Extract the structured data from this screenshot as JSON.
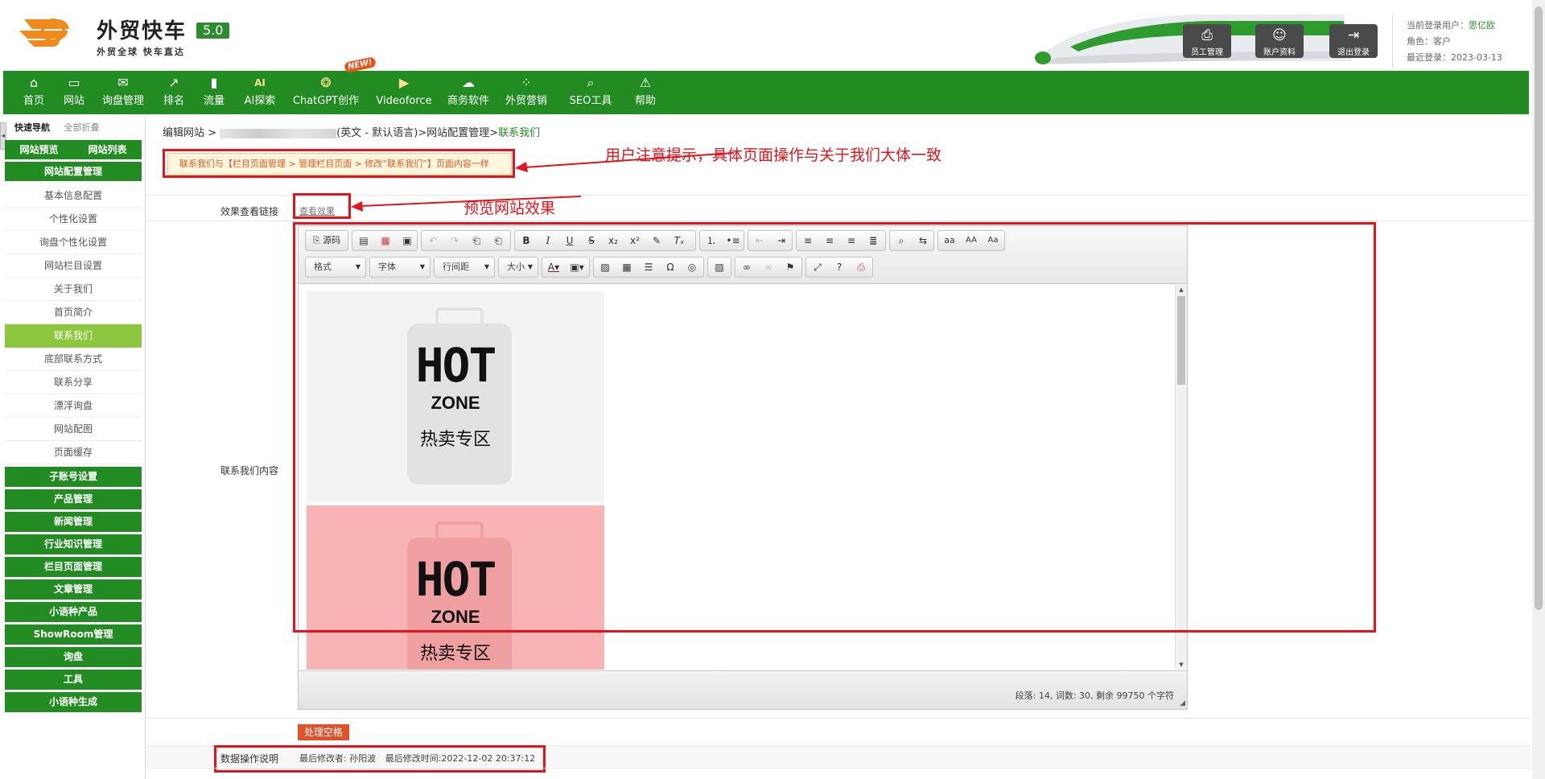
{
  "brand": {
    "name": "外贸快车",
    "version": "5.0",
    "slogan": "外贸全球 快车直达"
  },
  "header_buttons": [
    {
      "label": "员工管理",
      "icon": "staff-icon"
    },
    {
      "label": "账户资料",
      "icon": "account-icon"
    },
    {
      "label": "退出登录",
      "icon": "logout-icon"
    }
  ],
  "user": {
    "current_prefix": "当前登录用户：",
    "current_user": "思亿欧",
    "role": "角色：客户",
    "last_login": "最近登录：2023-03-13"
  },
  "nav": [
    {
      "label": "首页",
      "icon": "home-icon",
      "glyph": "⌂"
    },
    {
      "label": "网站",
      "icon": "monitor-icon",
      "glyph": "▭"
    },
    {
      "label": "询盘管理",
      "icon": "mail-icon",
      "glyph": "✉"
    },
    {
      "label": "排名",
      "icon": "rank-icon",
      "glyph": "↗"
    },
    {
      "label": "流量",
      "icon": "bar-chart-icon",
      "glyph": "▮"
    },
    {
      "label": "AI探索",
      "icon": "ai-icon",
      "glyph": "AI"
    },
    {
      "label": "ChatGPT创作",
      "icon": "chatgpt-icon",
      "glyph": "❂"
    },
    {
      "label": "Videoforce",
      "icon": "video-icon",
      "glyph": "▶"
    },
    {
      "label": "商务软件",
      "icon": "cloud-icon",
      "glyph": "☁"
    },
    {
      "label": "外贸营销",
      "icon": "grid-icon",
      "glyph": "⁘"
    },
    {
      "label": "SEO工具",
      "icon": "search-icon",
      "glyph": "⌕"
    },
    {
      "label": "帮助",
      "icon": "warning-icon",
      "glyph": "⚠"
    }
  ],
  "nav_badge": "NEW!",
  "sidebar": {
    "quick_nav": "快速导航",
    "collapse_all": "全部折叠",
    "tabs": [
      "网站预览",
      "网站列表"
    ],
    "section": "网站配置管理",
    "sub_items": [
      "基本信息配置",
      "个性化设置",
      "询盘个性化设置",
      "网站栏目设置",
      "关于我们",
      "首页简介",
      "联系我们",
      "底部联系方式",
      "联系分享",
      "漂浮询盘",
      "网站配图",
      "页面缓存"
    ],
    "active_item": "联系我们",
    "groups": [
      "子账号设置",
      "产品管理",
      "新闻管理",
      "行业知识管理",
      "栏目页面管理",
      "文章管理",
      "小语种产品",
      "ShowRoom管理",
      "询盘",
      "工具",
      "小语种生成"
    ]
  },
  "breadcrumb": {
    "prefix": "编辑网站 >",
    "lang": "(英文 - 默认语言)",
    "middle": ">网站配置管理>",
    "current": "联系我们"
  },
  "notice": "联系我们与【栏目页面管理 > 管理栏目页面 > 修改“联系我们”】页面内容一样",
  "annotations": {
    "notice": "用户注意提示，具体页面操作与关于我们大体一致",
    "preview": "预览网站效果"
  },
  "form": {
    "preview_label": "效果查看链接",
    "preview_link": "查看效果",
    "content_label": "联系我们内容",
    "ops_label": "数据操作说明",
    "last_editor": "最后修改者: 孙阳波",
    "last_time": "最后修改时间:2022-12-02 20:37:12",
    "space_button": "处理空格"
  },
  "editor": {
    "source_label": "源码",
    "combos": [
      "格式",
      "字体",
      "行间距",
      "大小"
    ],
    "images": [
      {
        "hot": "HOT",
        "zone": "ZONE",
        "caption": "热卖专区",
        "bg": "#f3f3f3",
        "shape": "#e2e2e2"
      },
      {
        "hot": "HOT",
        "zone": "ZONE",
        "caption": "热卖专区",
        "bg": "#f8b4b4",
        "shape": "#f0a0a0"
      }
    ],
    "status": "段落: 14, 词数: 30, 剩余 99750 个字符"
  },
  "colors": {
    "brand_green": "#228b22",
    "active_green": "#8dc63f",
    "annotation_red": "#e4141b"
  }
}
